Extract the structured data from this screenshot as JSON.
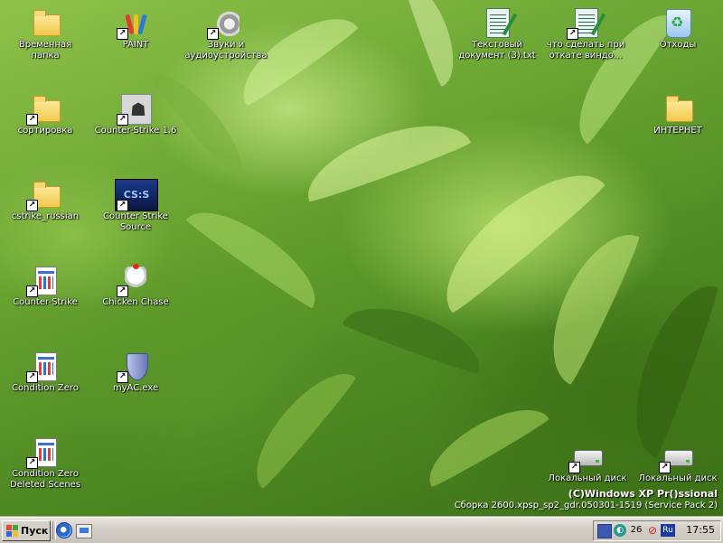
{
  "desktop": {
    "icons": [
      {
        "label": "Временная папка",
        "icon": "folder-icon",
        "shortcut": false
      },
      {
        "label": "PAINT",
        "icon": "paint-icon",
        "shortcut": true
      },
      {
        "label": "Звуки и аудиоустройства",
        "icon": "speaker-icon",
        "shortcut": true
      },
      {
        "label": "Текстовый документ (3).txt",
        "icon": "notepad-icon",
        "shortcut": false
      },
      {
        "label": "что сделать при откате виндо...",
        "icon": "notepad-icon",
        "shortcut": false
      },
      {
        "label": "Отходы",
        "icon": "recycle-bin-icon",
        "shortcut": false
      },
      {
        "label": "сортировка",
        "icon": "folder-icon",
        "shortcut": true
      },
      {
        "label": "Counter-Strike 1.6",
        "icon": "counter-strike-icon",
        "shortcut": true
      },
      {
        "label": "ИНТЕРНЕТ",
        "icon": "folder-icon",
        "shortcut": false
      },
      {
        "label": "cstrike_russian",
        "icon": "folder-icon",
        "shortcut": true
      },
      {
        "label": "Counter Strike Source",
        "icon": "counter-strike-source-icon",
        "shortcut": true
      },
      {
        "label": "Counter-Strike",
        "icon": "document-icon",
        "shortcut": true
      },
      {
        "label": "Chicken Chase",
        "icon": "chicken-icon",
        "shortcut": true
      },
      {
        "label": "Condition Zero",
        "icon": "document-icon",
        "shortcut": true
      },
      {
        "label": "myAC.exe",
        "icon": "shield-icon",
        "shortcut": true
      },
      {
        "label": "Condition Zero Deleted Scenes",
        "icon": "document-icon",
        "shortcut": true
      },
      {
        "label": "Локальный диск",
        "icon": "hard-drive-icon",
        "shortcut": true
      },
      {
        "label": "Локальный диск",
        "icon": "hard-drive-icon",
        "shortcut": true
      }
    ]
  },
  "watermark": {
    "line1": "(C)Windows XP Pr()ssional",
    "line2": "Сборка 2600.xpsp_sp2_gdr.050301-1519 (Service Pack 2)"
  },
  "taskbar": {
    "start_label": "Пуск",
    "quick_launch": [
      "internet-explorer-icon",
      "show-desktop-icon"
    ],
    "tray": {
      "icons": [
        "network-icon",
        "dial-up-icon",
        "temperature-icon",
        "blocked-icon",
        "language-icon"
      ],
      "temperature": "26",
      "language": "Ru",
      "clock": "17:55"
    }
  },
  "colors": {
    "taskbar": "#d4d0c8",
    "desktop_text": "#ffffff"
  }
}
